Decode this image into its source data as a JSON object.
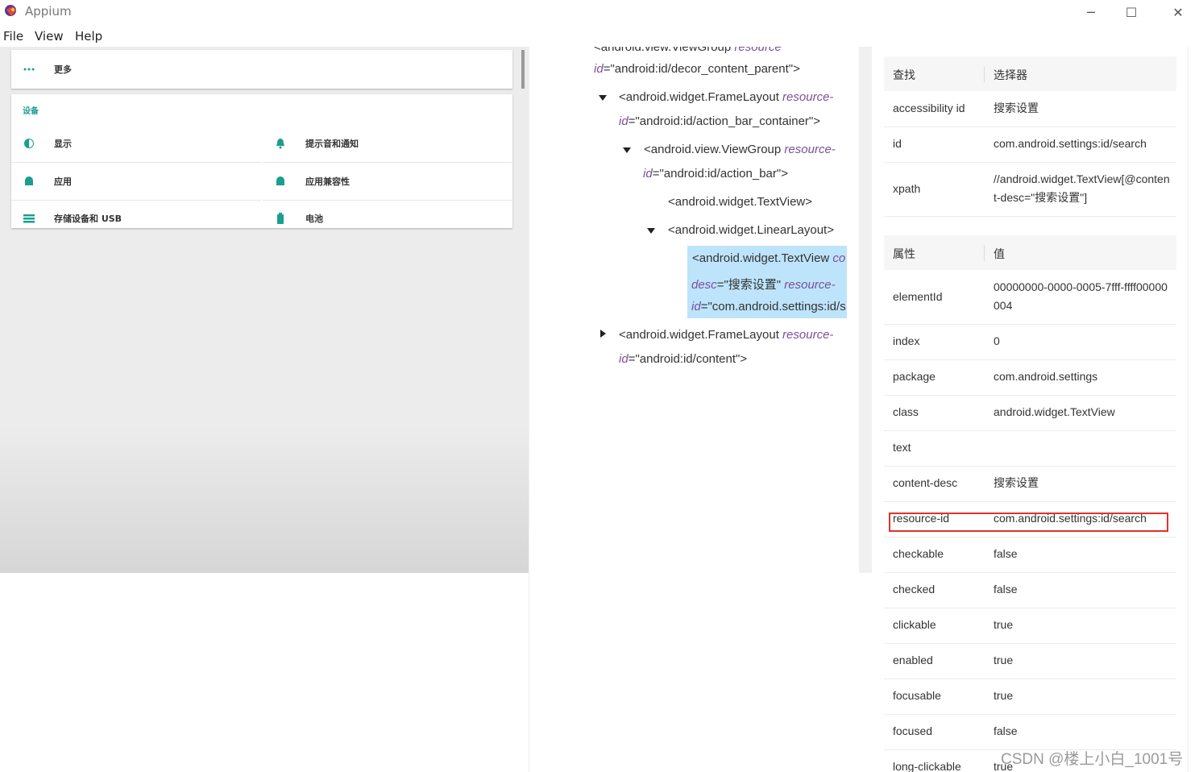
{
  "window": {
    "title": "Appium",
    "minimize": "─",
    "maximize": "☐",
    "close": "✕"
  },
  "menu": [
    "File",
    "View",
    "Help"
  ],
  "device": {
    "more_label": "更多",
    "section_title": "设备",
    "items": [
      {
        "label": "显示",
        "icon": "display-icon"
      },
      {
        "label": "提示音和通知",
        "icon": "bell-icon"
      },
      {
        "label": "应用",
        "icon": "android-icon"
      },
      {
        "label": "应用兼容性",
        "icon": "android-icon"
      },
      {
        "label": "存储设备和 USB",
        "icon": "storage-icon"
      },
      {
        "label": "电池",
        "icon": "battery-icon"
      }
    ],
    "accent_color": "#1a9e8f"
  },
  "tree": {
    "line0": {
      "tag": "<android.view.ViewGroup ",
      "attr": "resource"
    },
    "line1": {
      "attr": "id",
      "val": "=\"android:id/decor_content_parent\">"
    },
    "line2": {
      "tag": "<android.widget.FrameLayout ",
      "attr": "resource-"
    },
    "line3": {
      "attr": "id",
      "val": "=\"android:id/action_bar_container\">"
    },
    "line4": {
      "tag": "<android.view.ViewGroup ",
      "attr": "resource-"
    },
    "line5": {
      "attr": "id",
      "val": "=\"android:id/action_bar\">"
    },
    "line6": {
      "tag": "<android.widget.TextView>"
    },
    "line7": {
      "tag": "<android.widget.LinearLayout>"
    },
    "line8": {
      "tag": "<android.widget.TextView ",
      "attr": "co"
    },
    "line9": {
      "attr": "desc",
      "val": "=\"搜索设置\" ",
      "attr2": "resource-"
    },
    "line10": {
      "attr": "id",
      "val": "=\"com.android.settings:id/s"
    },
    "line11": {
      "tag": "<android.widget.FrameLayout ",
      "attr": "resource-"
    },
    "line12": {
      "attr": "id",
      "val": "=\"android:id/content\">"
    }
  },
  "selector_table": {
    "header": [
      "查找",
      "选择器"
    ],
    "rows": [
      {
        "k": "accessibility id",
        "v": "搜索设置"
      },
      {
        "k": "id",
        "v": "com.android.settings:id/search"
      },
      {
        "k": "xpath",
        "v": "//android.widget.TextView[@content-desc=\"搜索设置\"]"
      }
    ]
  },
  "attr_table": {
    "header": [
      "属性",
      "值"
    ],
    "rows": [
      {
        "k": "elementId",
        "v": "00000000-0000-0005-7fff-ffff00000004"
      },
      {
        "k": "index",
        "v": "0"
      },
      {
        "k": "package",
        "v": "com.android.settings"
      },
      {
        "k": "class",
        "v": "android.widget.TextView"
      },
      {
        "k": "text",
        "v": ""
      },
      {
        "k": "content-desc",
        "v": "搜索设置"
      },
      {
        "k": "resource-id",
        "v": "com.android.settings:id/search"
      },
      {
        "k": "checkable",
        "v": "false"
      },
      {
        "k": "checked",
        "v": "false"
      },
      {
        "k": "clickable",
        "v": "true"
      },
      {
        "k": "enabled",
        "v": "true"
      },
      {
        "k": "focusable",
        "v": "true"
      },
      {
        "k": "focused",
        "v": "false"
      },
      {
        "k": "long-clickable",
        "v": "true"
      }
    ]
  },
  "watermark": "CSDN @楼上小白_1001号"
}
